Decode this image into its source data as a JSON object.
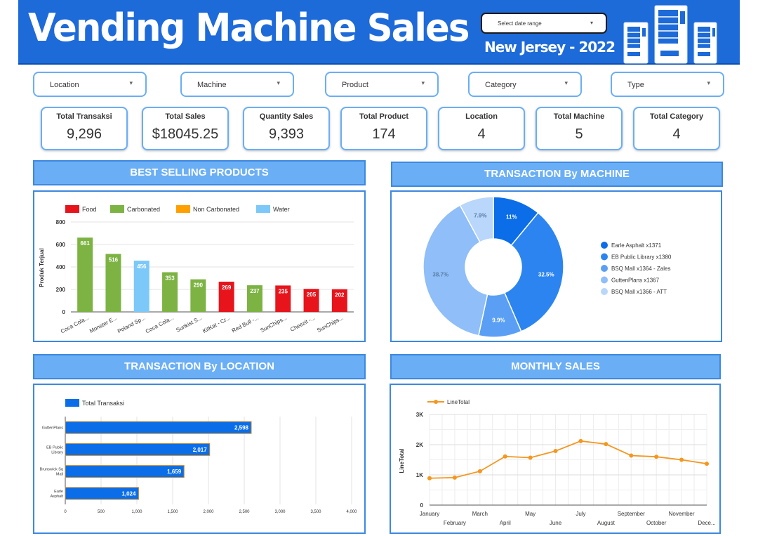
{
  "header": {
    "title": "Vending Machine Sales",
    "subtitle": "New Jersey - 2022",
    "date_range_label": "Select date range"
  },
  "filters": [
    "Location",
    "Machine",
    "Product",
    "Category",
    "Type"
  ],
  "kpis": [
    {
      "label": "Total Transaksi",
      "value": "9,296"
    },
    {
      "label": "Total Sales",
      "value": "$18045.25"
    },
    {
      "label": "Quantity Sales",
      "value": "9,393"
    },
    {
      "label": "Total Product",
      "value": "174"
    },
    {
      "label": "Location",
      "value": "4"
    },
    {
      "label": "Total Machine",
      "value": "5"
    },
    {
      "label": "Total Category",
      "value": "4"
    }
  ],
  "sections": {
    "best_selling": "BEST SELLING PRODUCTS",
    "by_machine": "TRANSACTION By MACHINE",
    "by_location": "TRANSACTION By LOCATION",
    "monthly": "MONTHLY SALES"
  },
  "colors": {
    "Food": "#e8141b",
    "Carbonated": "#7cb342",
    "Non Carbonated": "#ffa000",
    "Water": "#7cc8f8",
    "primary_blue": "#0b6ee8",
    "line_orange": "#f5961e"
  },
  "chart_data": [
    {
      "id": "best_selling",
      "type": "bar",
      "title": "BEST SELLING PRODUCTS",
      "ylabel": "Produk Terjual",
      "ylim": [
        0,
        800
      ],
      "yticks": [
        0,
        200,
        400,
        600,
        800
      ],
      "legend": [
        "Food",
        "Carbonated",
        "Non Carbonated",
        "Water"
      ],
      "legend_position": "top-left",
      "categories": [
        "Coca Cola...",
        "Monster E...",
        "Poland Sp...",
        "Coca Cola...",
        "Sunkist S...",
        "KitKat - Cr...",
        "Red Bull -...",
        "SunChips...",
        "Cheezit -...",
        "SunChips..."
      ],
      "values": [
        661,
        516,
        456,
        353,
        290,
        269,
        237,
        235,
        205,
        202
      ],
      "value_labels": [
        "661",
        "516",
        "456",
        "353",
        "290",
        "269",
        "237",
        "235",
        "205",
        "202"
      ],
      "bar_category": [
        "Carbonated",
        "Carbonated",
        "Water",
        "Carbonated",
        "Carbonated",
        "Food",
        "Carbonated",
        "Food",
        "Food",
        "Food"
      ],
      "grid": true
    },
    {
      "id": "by_machine",
      "type": "pie",
      "title": "TRANSACTION By MACHINE",
      "donut": true,
      "slices": [
        {
          "name": "Earle Asphalt x1371",
          "value": 11,
          "label": "11%",
          "color": "#0b6ee8"
        },
        {
          "name": "EB Public Library x1380",
          "value": 32.5,
          "label": "32.5%",
          "color": "#2b84ef"
        },
        {
          "name": "BSQ Mall x1364 - Zales",
          "value": 9.9,
          "label": "9.9%",
          "color": "#5a9ff4"
        },
        {
          "name": "GuttenPlans x1367",
          "value": 38.7,
          "label": "38.7%",
          "color": "#8fbef8"
        },
        {
          "name": "BSQ Mall x1366 - ATT",
          "value": 7.9,
          "label": "7.9%",
          "color": "#b9d6fb"
        }
      ],
      "legend_position": "right"
    },
    {
      "id": "by_location",
      "type": "bar",
      "orientation": "horizontal",
      "title": "TRANSACTION By LOCATION",
      "legend": [
        "Total Transaksi"
      ],
      "legend_position": "top-left",
      "categories": [
        "GuttenPlans",
        "EB Public Library",
        "Brunswick Sq Mall",
        "Earle Asphalt"
      ],
      "values": [
        2598,
        2017,
        1659,
        1024
      ],
      "value_labels": [
        "2,598",
        "2,017",
        "1,659",
        "1,024"
      ],
      "xlim": [
        0,
        4000
      ],
      "xticks": [
        "0",
        "500",
        "1,000",
        "1,500",
        "2,000",
        "2,500",
        "3,000",
        "3,500",
        "4,000"
      ],
      "grid": true
    },
    {
      "id": "monthly",
      "type": "line",
      "title": "MONTHLY SALES",
      "ylabel": "LineTotal",
      "legend": [
        "LineTotal"
      ],
      "legend_position": "top-left",
      "ylim": [
        0,
        3000
      ],
      "yticks": [
        "0",
        "1K",
        "2K",
        "3K"
      ],
      "x": [
        "January",
        "February",
        "March",
        "April",
        "May",
        "June",
        "July",
        "August",
        "September",
        "October",
        "November",
        "Dece..."
      ],
      "values": [
        890,
        910,
        1120,
        1610,
        1570,
        1790,
        2120,
        2020,
        1640,
        1600,
        1500,
        1370
      ],
      "grid": true
    }
  ]
}
